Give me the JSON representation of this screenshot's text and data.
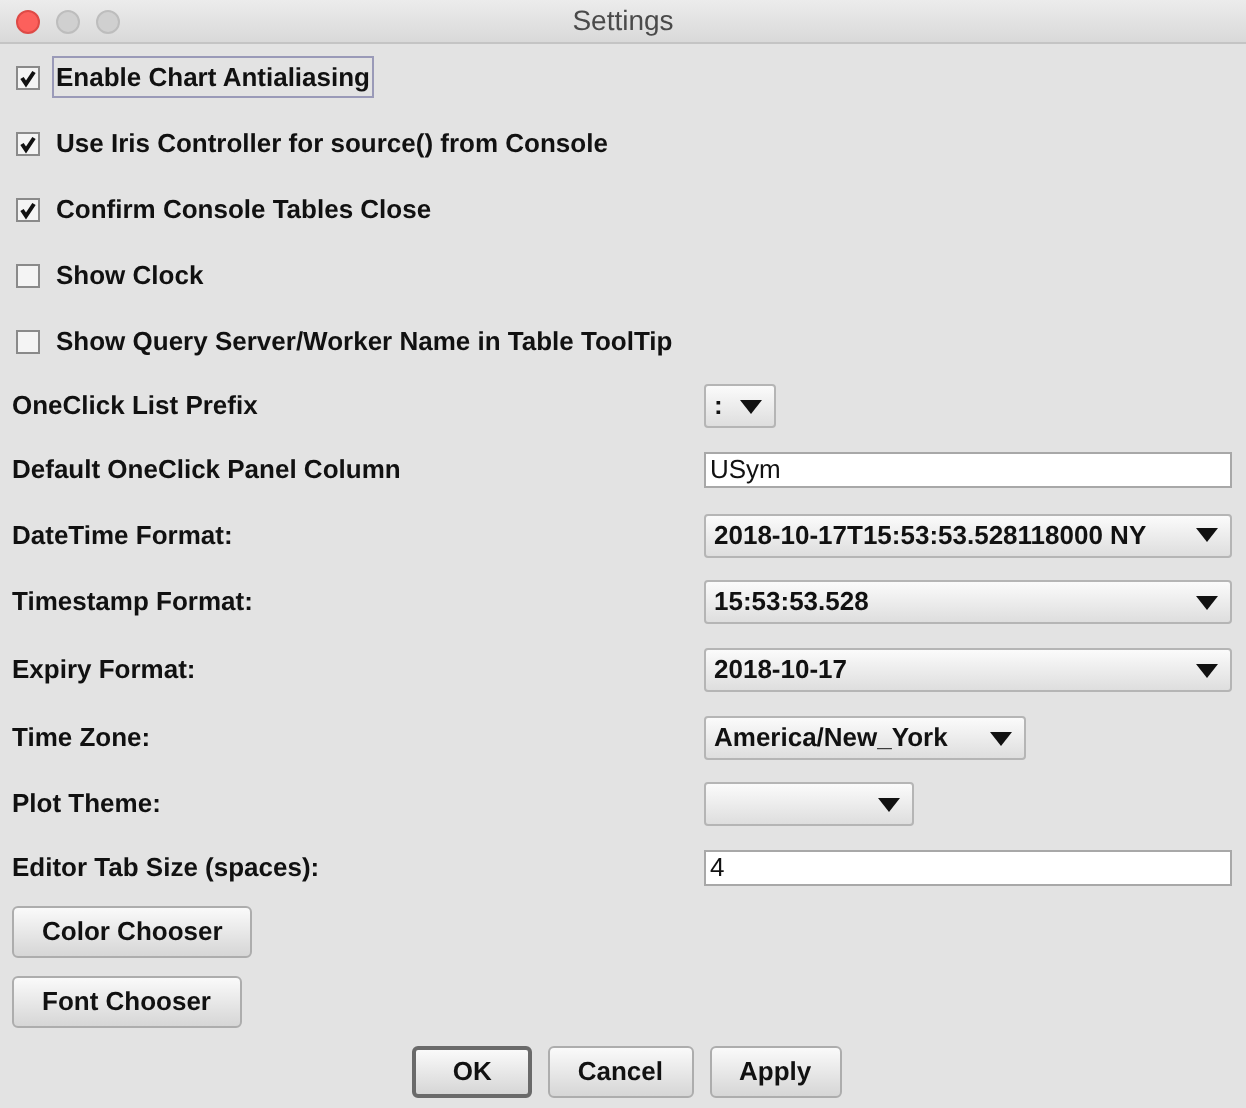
{
  "window": {
    "title": "Settings"
  },
  "checkboxes": [
    {
      "label": "Enable Chart Antialiasing",
      "checked": true,
      "focused": true
    },
    {
      "label": "Use Iris Controller for source() from Console",
      "checked": true,
      "focused": false
    },
    {
      "label": "Confirm Console Tables Close",
      "checked": true,
      "focused": false
    },
    {
      "label": "Show Clock",
      "checked": false,
      "focused": false
    },
    {
      "label": "Show Query Server/Worker Name in Table ToolTip",
      "checked": false,
      "focused": false
    }
  ],
  "fields": [
    {
      "label": "OneClick List Prefix",
      "kind": "combo",
      "value": ":"
    },
    {
      "label": "Default OneClick Panel Column",
      "kind": "text",
      "value": "USym"
    },
    {
      "label": "DateTime Format:",
      "kind": "combo",
      "value": "2018-10-17T15:53:53.528118000 NY"
    },
    {
      "label": "Timestamp Format:",
      "kind": "combo",
      "value": "15:53:53.528"
    },
    {
      "label": "Expiry Format:",
      "kind": "combo",
      "value": "2018-10-17"
    },
    {
      "label": "Time Zone:",
      "kind": "combo",
      "value": "America/New_York"
    },
    {
      "label": "Plot Theme:",
      "kind": "combo"
    },
    {
      "label": "Editor Tab Size (spaces):",
      "kind": "text",
      "value": "4"
    }
  ],
  "chooser_buttons": [
    "Color Chooser",
    "Font Chooser"
  ],
  "buttons": [
    {
      "label": "OK",
      "default": true
    },
    {
      "label": "Cancel",
      "default": false
    },
    {
      "label": "Apply",
      "default": false
    }
  ]
}
